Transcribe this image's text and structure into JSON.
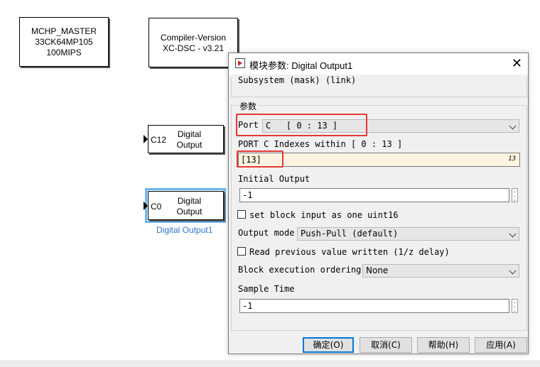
{
  "canvas": {
    "master_block": {
      "line1": "MCHP_MASTER",
      "line2": "33CK64MP105",
      "line3": "100MIPS"
    },
    "compiler_block": {
      "line1": "Compiler-Version",
      "line2": "XC-DSC - v3.21"
    },
    "block_c12": {
      "port_label": "C12",
      "line1": "Digital",
      "line2": "Output"
    },
    "block_c0": {
      "port_label": "C0",
      "line1": "Digital",
      "line2": "Output",
      "name": "Digital Output1"
    }
  },
  "dialog": {
    "title": "模块参数: Digital Output1",
    "icon": "simulink-block-icon",
    "close_glyph": "✕",
    "subsystem_text": "Subsystem (mask) (link)",
    "params_group_label": "参数",
    "port": {
      "label": "Port",
      "value": "C   [ 0 : 13 ]"
    },
    "indexes": {
      "label": "PORT C Indexes within [ 0 : 13 ]",
      "value": "[13]",
      "hint": "13"
    },
    "initial_output": {
      "label": "Initial Output",
      "value": "-1"
    },
    "set_block_input": {
      "label": "set block input as one uint16",
      "checked": false
    },
    "output_mode": {
      "label": "Output mode",
      "value": "Push-Pull (default)"
    },
    "read_previous": {
      "label": "Read previous value written (1/z delay)",
      "checked": false
    },
    "block_exec": {
      "label": "Block execution ordering",
      "value": "None"
    },
    "sample_time": {
      "label": "Sample Time",
      "value": "-1"
    },
    "buttons": {
      "ok": "确定(O)",
      "cancel": "取消(C)",
      "help": "帮助(H)",
      "apply": "应用(A)"
    }
  }
}
